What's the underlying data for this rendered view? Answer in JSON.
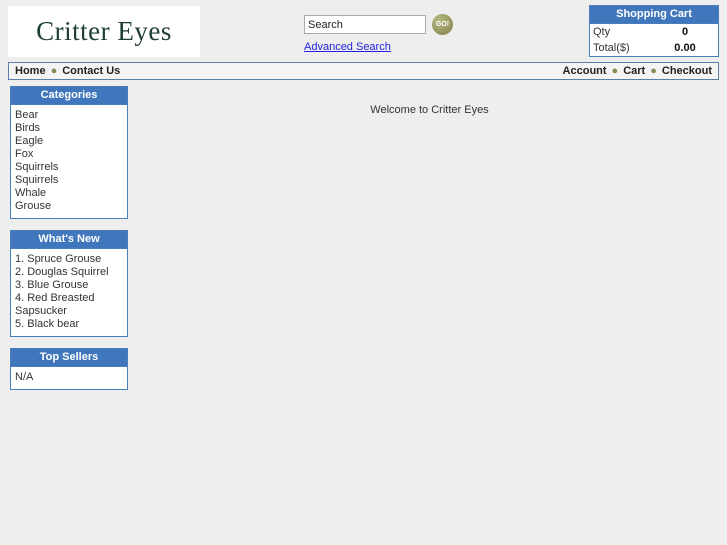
{
  "site": {
    "logo": "Critter Eyes"
  },
  "search": {
    "value": "Search",
    "placeholder": "Search",
    "go_label": "GO!",
    "advanced_link": "Advanced Search"
  },
  "cart": {
    "title": "Shopping Cart",
    "rows": [
      {
        "label": "Qty",
        "value": "0"
      },
      {
        "label": "Total($)",
        "value": "0.00"
      }
    ]
  },
  "nav": {
    "left": [
      "Home",
      "Contact Us"
    ],
    "right": [
      "Account",
      "Cart",
      "Checkout"
    ],
    "separator": "●"
  },
  "sidebar": {
    "panels": [
      {
        "title": "Categories",
        "items": [
          "Bear",
          "Birds",
          "Eagle",
          "Fox",
          "Squirrels",
          "Squirrels",
          "Whale",
          "Grouse"
        ]
      },
      {
        "title": "What's New",
        "items": [
          "1. Spruce Grouse",
          "2. Douglas Squirrel",
          "3. Blue Grouse",
          "4. Red Breasted Sapsucker",
          "5. Black bear"
        ]
      },
      {
        "title": "Top Sellers",
        "items": [
          "N/A"
        ]
      }
    ]
  },
  "main": {
    "welcome": "Welcome to Critter Eyes"
  },
  "colors": {
    "panel_header_blue": "#4077bc",
    "panel_border_blue": "#4a7ebb",
    "page_background": "#eeeeee",
    "logo_green": "#1f4031",
    "link_blue": "#2222dd",
    "bullet_olive": "#8a8a55",
    "go_button_olive": "#9a9a63"
  }
}
